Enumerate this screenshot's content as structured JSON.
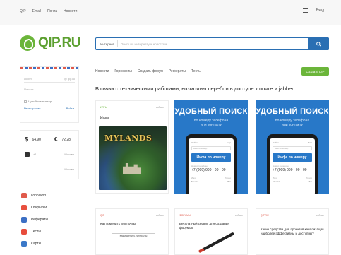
{
  "topnav": {
    "links": [
      "QIP",
      "Email",
      "Почта",
      "Новости"
    ],
    "login": "Вход"
  },
  "logo": {
    "text": "QIP.RU"
  },
  "search": {
    "category": "Интернет",
    "placeholder": "Поиск по интернету и новостям"
  },
  "login_box": {
    "login_placeholder": "Логин",
    "domain": "@ qip.ru",
    "password_placeholder": "Пароль",
    "remember": "Чужой компьютер",
    "register": "Регистрация",
    "exit": "Войти"
  },
  "rates": {
    "usd_symbol": "$",
    "usd_value": "64.90",
    "eur_symbol": "€",
    "eur_value": "72.28",
    "weather_city": "Москва",
    "weather_temp": "+1",
    "weather_extra": "Москва"
  },
  "services": [
    {
      "label": "Гороскоп",
      "color": "#e05a4b"
    },
    {
      "label": "Открытки",
      "color": "#e8503f"
    },
    {
      "label": "Рефераты",
      "color": "#3c6fc4"
    },
    {
      "label": "Тесты",
      "color": "#e74c3c"
    },
    {
      "label": "Карты",
      "color": "#3a78c8"
    }
  ],
  "subnav": [
    "Новости",
    "Гороскопы",
    "Создать форум",
    "Рефераты",
    "Тесты"
  ],
  "create_button": "Создать QIP",
  "notice": "В связи с техническими работами, возможны перебои в доступе к почте и jabber.",
  "game_card": {
    "tag": "ИГРЫ",
    "date": "сейчас",
    "title": "Игры",
    "logo": "MYLANDS"
  },
  "ads": [
    {
      "title": "УДОБНЫЙ ПОИСК",
      "subtitle_1": "по номеру телефона",
      "subtitle_2": "или контакту",
      "screen_top_left": "Найти",
      "screen_top_right": "Ещё",
      "screen_input": "Ввести номер",
      "screen_button": "Инфа по номеру",
      "screen_label": "Номер телефона",
      "screen_number": "+7 (999) 999 - 99 - 99",
      "screen_footer_left": "Имя",
      "screen_footer_right": "Город",
      "screen_footer_left_val": "Москва",
      "screen_footer_right_val": "Мск"
    },
    {
      "title": "УДОБНЫЙ ПОИСК",
      "subtitle_1": "по номеру телефона",
      "subtitle_2": "или контакту",
      "screen_top_left": "Найти",
      "screen_top_right": "Ещё",
      "screen_input": "Ввести номер",
      "screen_button": "Инфа по номеру",
      "screen_label": "Номер телефона",
      "screen_number": "+7 (999) 999 - 99 - 99",
      "screen_footer_left": "Имя",
      "screen_footer_right": "Город",
      "screen_footer_left_val": "Москва",
      "screen_footer_right_val": "Мск"
    }
  ],
  "bottom_cards": [
    {
      "tag": "QIP",
      "date": "сейчас",
      "title": "Как изменить тип почты",
      "button": "Как изменить тип почты"
    },
    {
      "tag": "ФОРУМЫ",
      "date": "сейчас",
      "title": "Бесплатный сервис для создания форумов"
    },
    {
      "tag": "QIP.RU",
      "date": "сейчас",
      "title": "Какие средства для проектов канализации наиболее эффективны и доступны?"
    }
  ]
}
